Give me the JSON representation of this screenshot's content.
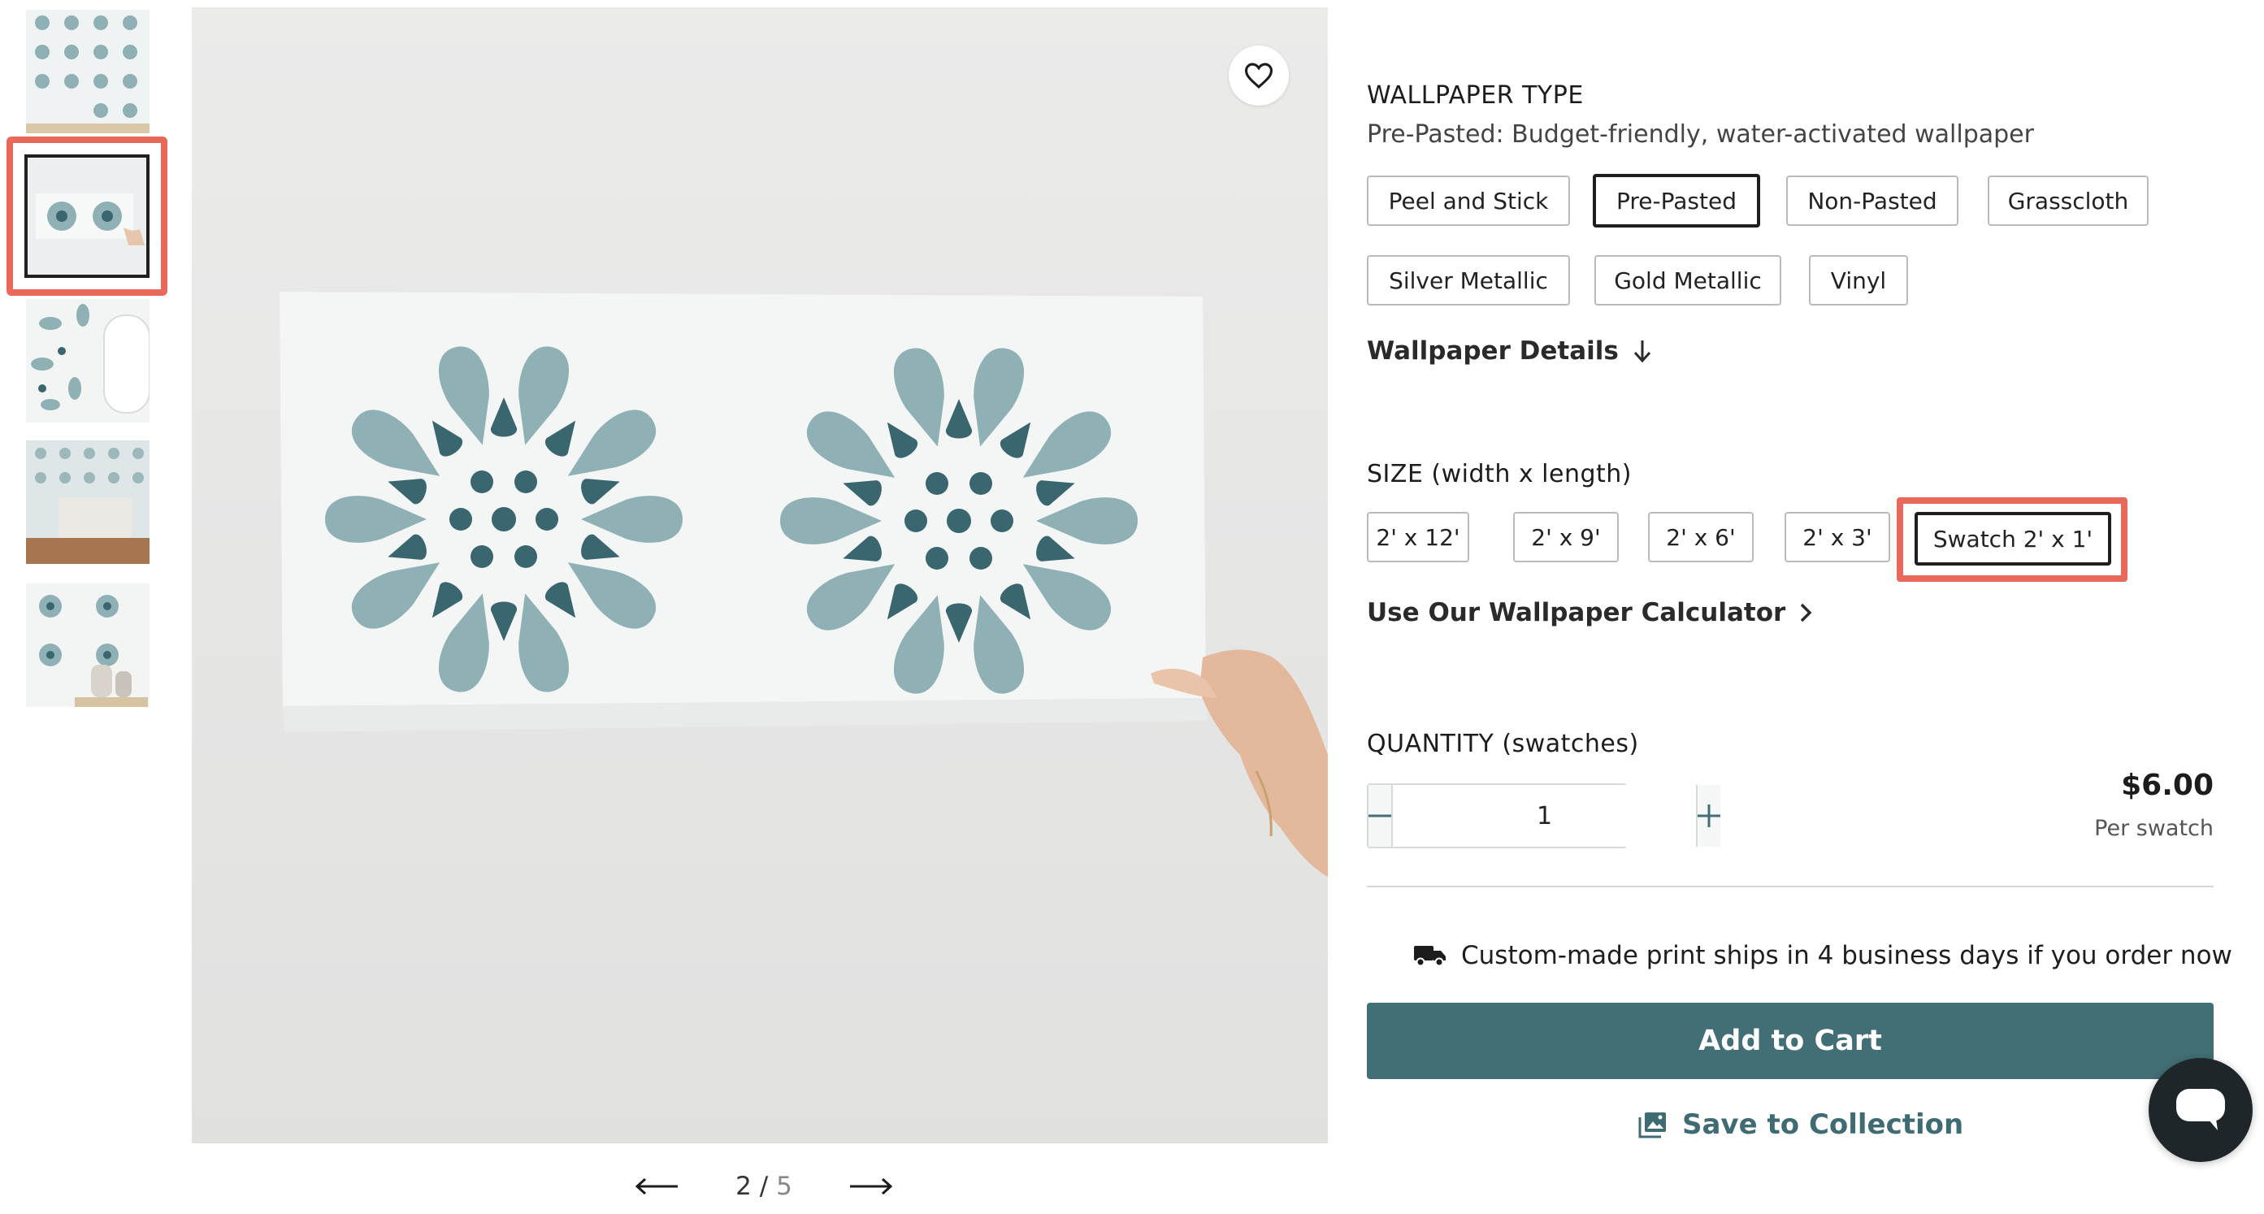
{
  "gallery": {
    "current": "2",
    "separator": "/",
    "total": "5",
    "prev_icon": "arrow-left-icon",
    "next_icon": "arrow-right-icon",
    "favorite_icon": "heart-icon"
  },
  "wallpaper_type": {
    "heading": "WALLPAPER TYPE",
    "description": "Pre-Pasted: Budget-friendly, water-activated wallpaper",
    "options": [
      "Peel and Stick",
      "Pre-Pasted",
      "Non-Pasted",
      "Grasscloth",
      "Silver Metallic",
      "Gold Metallic",
      "Vinyl"
    ],
    "selected": "Pre-Pasted"
  },
  "details_link": {
    "label": "Wallpaper Details",
    "icon": "arrow-down-icon"
  },
  "size": {
    "heading": "SIZE (width x length)",
    "options": [
      "2' x 12'",
      "2' x 9'",
      "2' x 6'",
      "2' x 3'",
      "Swatch 2' x 1'"
    ],
    "selected": "Swatch 2' x 1'"
  },
  "calculator_link": {
    "label": "Use Our Wallpaper Calculator",
    "icon": "chevron-right-icon"
  },
  "quantity": {
    "heading": "QUANTITY (swatches)",
    "value": "1",
    "minus_icon": "minus-icon",
    "plus_icon": "plus-icon"
  },
  "price": {
    "amount": "$6.00",
    "unit": "Per swatch"
  },
  "shipping": {
    "text": "Custom-made print ships in 4 business days if you order now",
    "icon": "truck-icon"
  },
  "actions": {
    "add_to_cart": "Add to Cart",
    "save_to_collection": "Save to Collection",
    "save_icon": "image-stack-icon",
    "chat_icon": "chat-bubble-icon"
  },
  "colors": {
    "accent": "#426e75",
    "highlight": "#e8685a",
    "petal_light": "#8fb1b5",
    "petal_dark": "#3a6670"
  }
}
